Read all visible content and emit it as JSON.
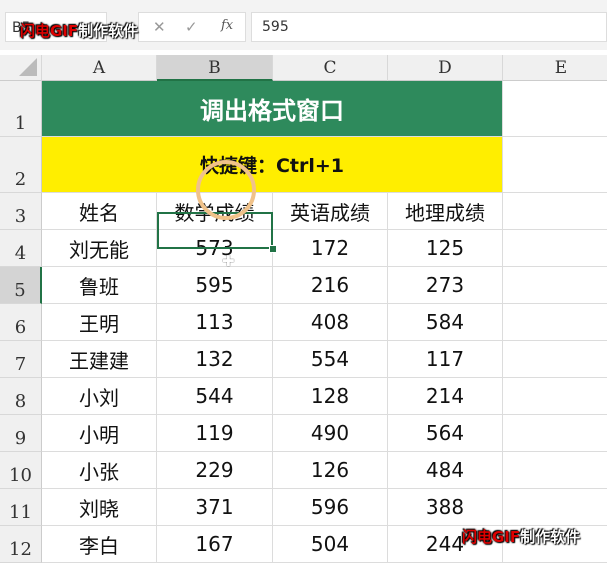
{
  "formula_bar": {
    "name_box": "B5",
    "cancel_icon": "✕",
    "enter_icon": "✓",
    "fx_label": "fx",
    "value": "595"
  },
  "watermark": {
    "red": "闪电GIF",
    "white": "制作软件"
  },
  "columns": [
    "A",
    "B",
    "C",
    "D",
    "E"
  ],
  "rows": [
    "1",
    "2",
    "3",
    "4",
    "5",
    "6",
    "7",
    "8",
    "9",
    "10",
    "11",
    "12"
  ],
  "title": "调出格式窗口",
  "shortcut": "快捷键：Ctrl+1",
  "headers": [
    "姓名",
    "数学成绩",
    "英语成绩",
    "地理成绩"
  ],
  "data": [
    [
      "刘无能",
      "573",
      "172",
      "125"
    ],
    [
      "鲁班",
      "595",
      "216",
      "273"
    ],
    [
      "王明",
      "113",
      "408",
      "584"
    ],
    [
      "王建建",
      "132",
      "554",
      "117"
    ],
    [
      "小刘",
      "544",
      "128",
      "214"
    ],
    [
      "小明",
      "119",
      "490",
      "564"
    ],
    [
      "小张",
      "229",
      "126",
      "484"
    ],
    [
      "刘晓",
      "371",
      "596",
      "388"
    ],
    [
      "李白",
      "167",
      "504",
      "244"
    ]
  ],
  "colors": {
    "title_bg": "#2e8a5c",
    "shortcut_bg": "#ffee00",
    "selection": "#217346"
  }
}
